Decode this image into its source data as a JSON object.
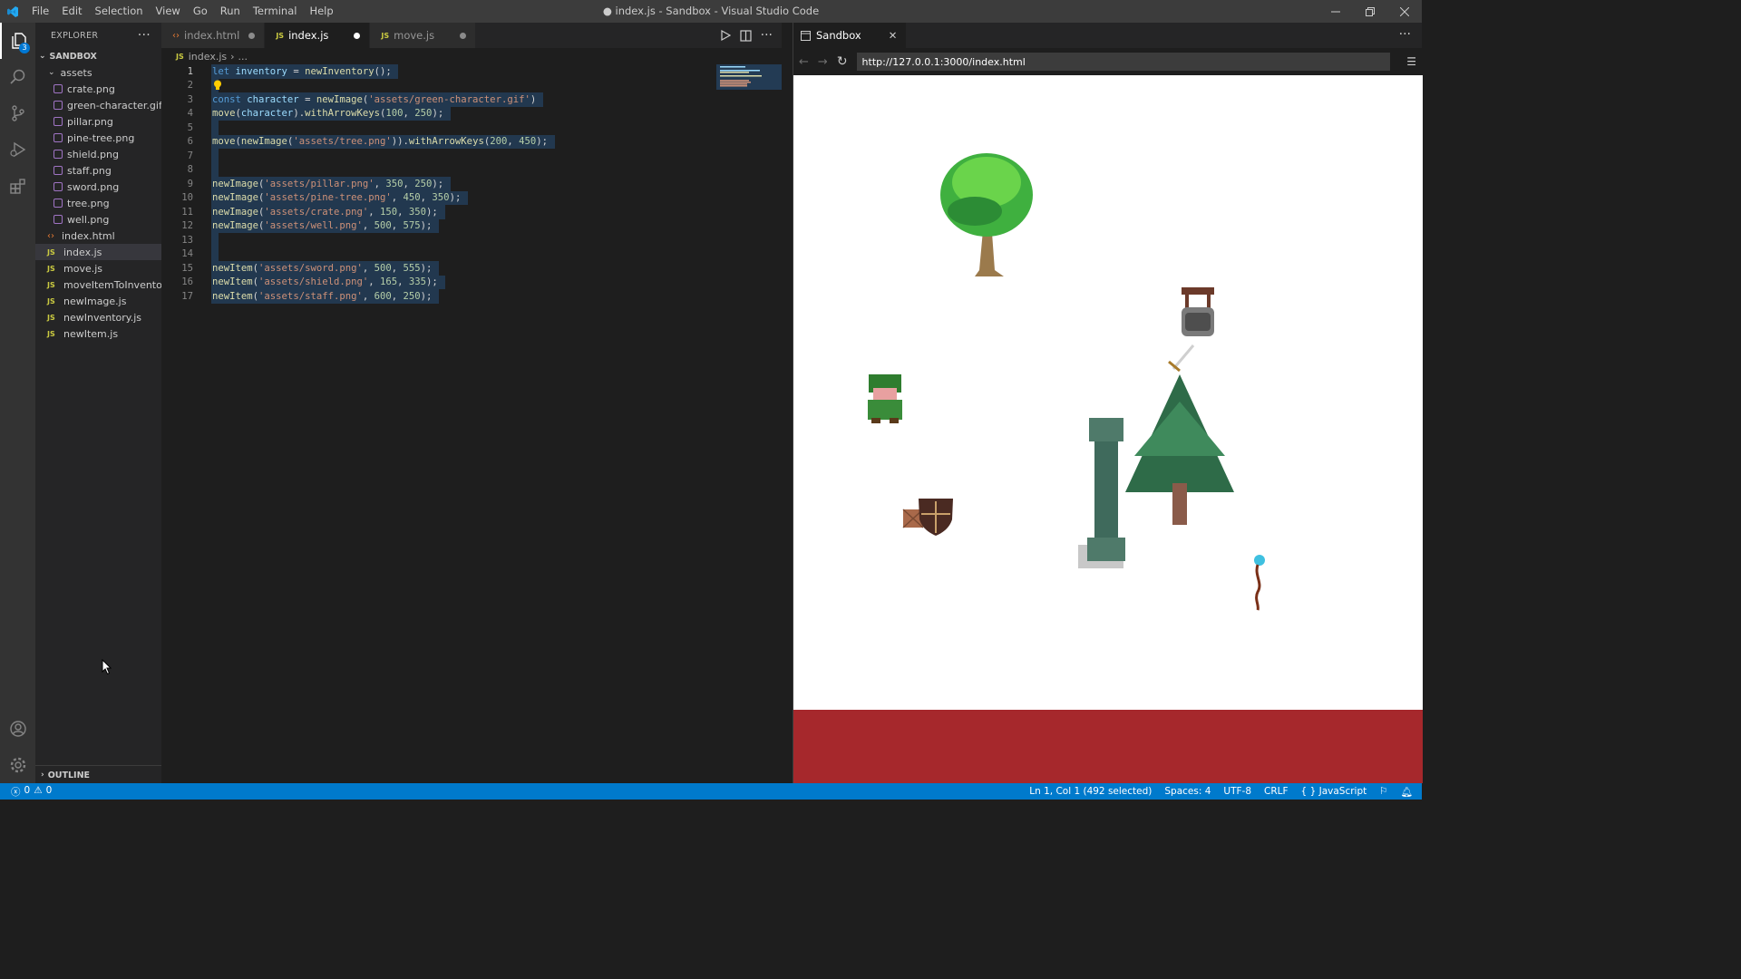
{
  "window": {
    "title": "● index.js - Sandbox - Visual Studio Code",
    "menu": [
      "File",
      "Edit",
      "Selection",
      "View",
      "Go",
      "Run",
      "Terminal",
      "Help"
    ]
  },
  "activity": {
    "explorer_badge": "3"
  },
  "sidebar": {
    "header": "EXPLORER",
    "root": "SANDBOX",
    "folder": "assets",
    "assets": [
      "crate.png",
      "green-character.gif",
      "pillar.png",
      "pine-tree.png",
      "shield.png",
      "staff.png",
      "sword.png",
      "tree.png",
      "well.png"
    ],
    "files": [
      {
        "name": "index.html",
        "type": "html"
      },
      {
        "name": "index.js",
        "type": "js"
      },
      {
        "name": "move.js",
        "type": "js"
      },
      {
        "name": "moveItemToInventory...",
        "type": "js"
      },
      {
        "name": "newImage.js",
        "type": "js"
      },
      {
        "name": "newInventory.js",
        "type": "js"
      },
      {
        "name": "newItem.js",
        "type": "js"
      }
    ],
    "outline": "OUTLINE"
  },
  "tabs": [
    {
      "label": "index.html",
      "icon": "<>"
    },
    {
      "label": "index.js",
      "icon": "JS"
    },
    {
      "label": "move.js",
      "icon": "JS"
    }
  ],
  "breadcrumb": {
    "file": "index.js",
    "rest": "..."
  },
  "code": {
    "line_numbers": [
      "1",
      "2",
      "3",
      "4",
      "5",
      "6",
      "7",
      "8",
      "9",
      "10",
      "11",
      "12",
      "13",
      "14",
      "15",
      "16",
      "17"
    ],
    "lines": [
      "let inventory = newInventory();",
      "",
      "const character = newImage('assets/green-character.gif')",
      "move(character).withArrowKeys(100, 250);",
      "",
      "move(newImage('assets/tree.png')).withArrowKeys(200, 450);",
      "",
      "",
      "newImage('assets/pillar.png', 350, 250);",
      "newImage('assets/pine-tree.png', 450, 350);",
      "newImage('assets/crate.png', 150, 350);",
      "newImage('assets/well.png', 500, 575);",
      "",
      "",
      "newItem('assets/sword.png', 500, 555);",
      "newItem('assets/shield.png', 165, 335);",
      "newItem('assets/staff.png', 600, 250);"
    ]
  },
  "preview": {
    "tab": "Sandbox",
    "url": "http://127.0.0.1:3000/index.html"
  },
  "status": {
    "errors": "0",
    "warnings": "0",
    "position": "Ln 1, Col 1 (492 selected)",
    "spaces": "Spaces: 4",
    "encoding": "UTF-8",
    "eol": "CRLF",
    "language": "JavaScript",
    "language_prefix": "{ }"
  },
  "colors": {
    "accent": "#007acc",
    "floor": "#a6282c",
    "selection": "#264f78"
  }
}
